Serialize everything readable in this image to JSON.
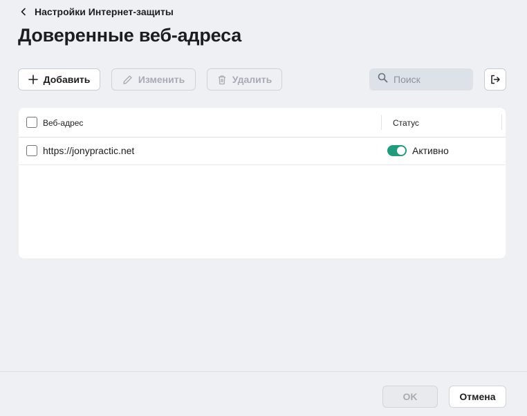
{
  "breadcrumb": {
    "label": "Настройки Интернет-защиты",
    "icon": "chevron-left-icon"
  },
  "page": {
    "title": "Доверенные веб-адреса"
  },
  "toolbar": {
    "add_label": "Добавить",
    "edit_label": "Изменить",
    "delete_label": "Удалить",
    "search_placeholder": "Поиск"
  },
  "table": {
    "columns": [
      "Веб-адрес",
      "Статус"
    ],
    "rows": [
      {
        "url": "https://jonypractic.net",
        "status": "Активно",
        "enabled": true,
        "checked": false
      }
    ]
  },
  "footer": {
    "ok_label": "OK",
    "cancel_label": "Отмена"
  },
  "colors": {
    "background": "#eff0f4",
    "toggle_on": "#1f9c7d",
    "search_bg": "#dde1e8",
    "disabled_text": "#a7abb4"
  }
}
